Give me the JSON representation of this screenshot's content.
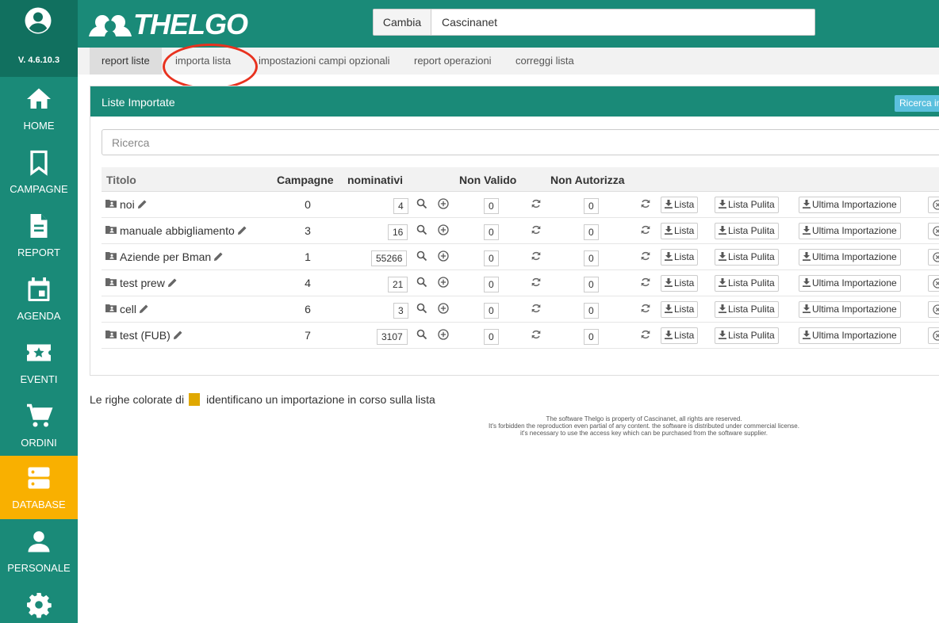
{
  "app": {
    "version": "V. 4.6.10.3",
    "logo_text": "THELGO",
    "colors": {
      "primary": "#1a8a78",
      "primary_dark": "#11705f",
      "active": "#f9b000",
      "highlight_ring": "#e8321f",
      "info": "#5bc0de"
    }
  },
  "header": {
    "cambia_label": "Cambia",
    "tenant_value": "Cascinanet"
  },
  "sidebar": {
    "items": [
      {
        "label": "HOME",
        "icon": "home-icon"
      },
      {
        "label": "CAMPAGNE",
        "icon": "bookmark-icon"
      },
      {
        "label": "REPORT",
        "icon": "document-icon"
      },
      {
        "label": "AGENDA",
        "icon": "calendar-icon"
      },
      {
        "label": "EVENTI",
        "icon": "ticket-star-icon"
      },
      {
        "label": "ORDINI",
        "icon": "cart-icon"
      },
      {
        "label": "DATABASE",
        "icon": "database-icon",
        "active": true
      },
      {
        "label": "PERSONALE",
        "icon": "person-icon"
      },
      {
        "label": "",
        "icon": "gear-icon"
      }
    ]
  },
  "tabs": [
    {
      "label": "report liste",
      "active": true
    },
    {
      "label": "importa lista"
    },
    {
      "label": "impostazioni campi opzionali"
    },
    {
      "label": "report operazioni"
    },
    {
      "label": "correggi lista"
    }
  ],
  "panel": {
    "title": "Liste Importate",
    "ricerca_button": "Ricerca in",
    "search_placeholder": "Ricerca"
  },
  "table": {
    "headers": {
      "titolo": "Titolo",
      "campagne": "Campagne",
      "nominativi": "nominativi",
      "non_valido": "Non Valido",
      "non_autorizza": "Non Autorizza"
    },
    "buttons": {
      "lista": "Lista",
      "lista_pulita": "Lista Pulita",
      "ultima_importazione": "Ultima Importazione"
    },
    "rows": [
      {
        "titolo": "noi",
        "campagne": "0",
        "nominativi": "4",
        "non_valido": "0",
        "non_autorizza": "0"
      },
      {
        "titolo": "manuale abbigliamento",
        "campagne": "3",
        "nominativi": "16",
        "non_valido": "0",
        "non_autorizza": "0"
      },
      {
        "titolo": "Aziende per Bman",
        "campagne": "1",
        "nominativi": "55266",
        "non_valido": "0",
        "non_autorizza": "0"
      },
      {
        "titolo": "test prew",
        "campagne": "4",
        "nominativi": "21",
        "non_valido": "0",
        "non_autorizza": "0"
      },
      {
        "titolo": "cell",
        "campagne": "6",
        "nominativi": "3",
        "non_valido": "0",
        "non_autorizza": "0"
      },
      {
        "titolo": "test (FUB)",
        "campagne": "7",
        "nominativi": "3107",
        "non_valido": "0",
        "non_autorizza": "0"
      }
    ]
  },
  "legend": {
    "prefix": "Le righe colorate di",
    "suffix": "identificano un importazione in corso sulla lista",
    "swatch_color": "#e0a800"
  },
  "footer": {
    "line1": "The software Thelgo is property of Cascinanet, all rights are reserved.",
    "line2": "It's forbidden the reproduction even partial of any content. the software is distributed under commercial license.",
    "line3": "it's necessary to use the access key which can be purchased from the software supplier."
  }
}
